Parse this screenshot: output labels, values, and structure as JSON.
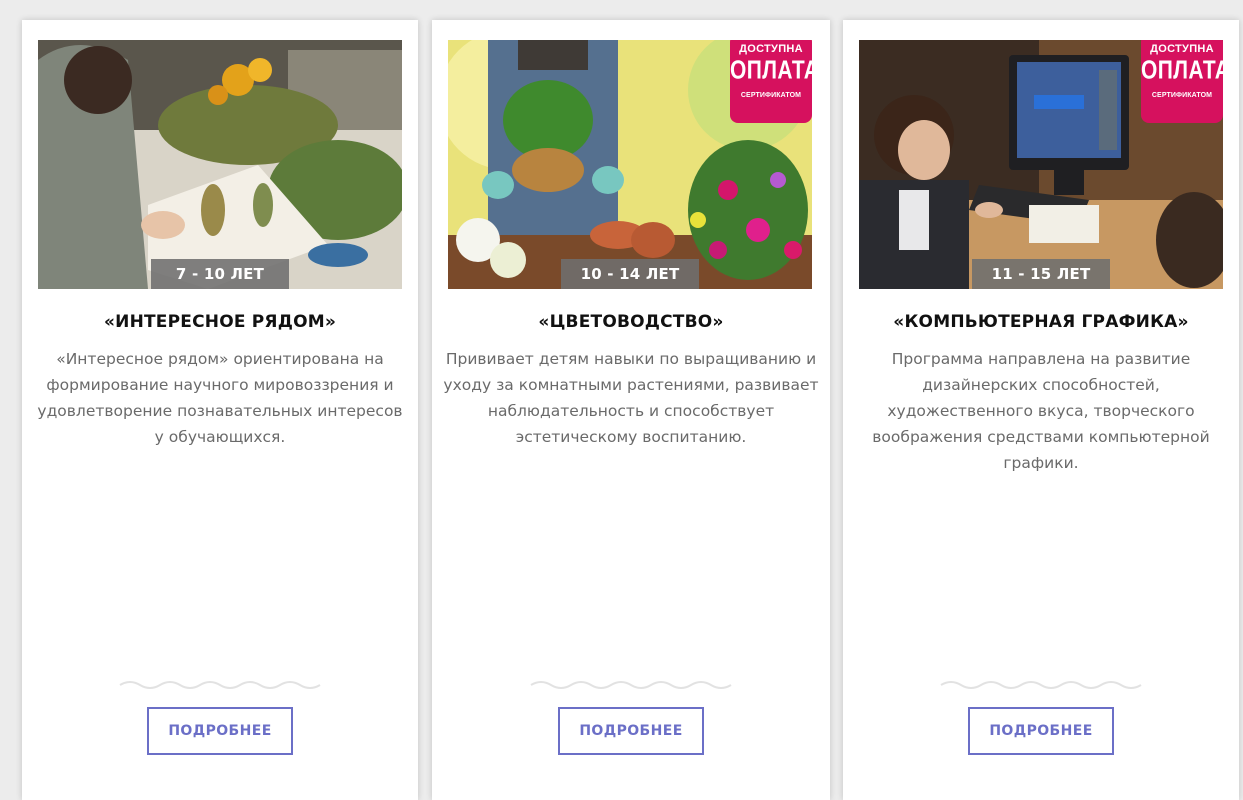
{
  "colors": {
    "background": "#ececec",
    "card": "#ffffff",
    "age_label_bg": "#6e6e6e",
    "badge": "#d6115e",
    "button_border": "#6b6fc7",
    "title_text": "#111111",
    "description_text": "#6a6a6a"
  },
  "cards": [
    {
      "age": "7 - 10 ЛЕТ",
      "title": "«ИНТЕРЕСНОЕ РЯДОМ»",
      "description": "«Интересное рядом» ориентирована на формирование научного мировоззрения и удовлетворение познавательных интересов у обучающихся.",
      "button_label": "ПОДРОБНЕЕ",
      "image": "person-with-herbarium-book-photo"
    },
    {
      "age": "10 - 14 ЛЕТ",
      "title": "«ЦВЕТОВОДСТВО»",
      "description": "Прививает детям навыки по выращиванию и уходу за комнатными растениями, развивает наблюдательность и способствует эстетическому воспитанию.",
      "button_label": "ПОДРОБНЕЕ",
      "image": "gardener-with-potted-plant-photo",
      "badge": {
        "line1": "ДОСТУПНА",
        "line2": "ОПЛАТА",
        "line3": "СЕРТИФИКАТОМ"
      }
    },
    {
      "age": "11 - 15 ЛЕТ",
      "title": "«КОМПЬЮТЕРНАЯ ГРАФИКА»",
      "description": "Программа направлена на развитие дизайнерских способностей, художественного вкуса, творческого воображения средствами компьютерной графики.",
      "button_label": "ПОДРОБНЕЕ",
      "image": "children-at-computer-photo",
      "badge": {
        "line1": "ДОСТУПНА",
        "line2": "ОПЛАТА",
        "line3": "СЕРТИФИКАТОМ"
      }
    }
  ]
}
